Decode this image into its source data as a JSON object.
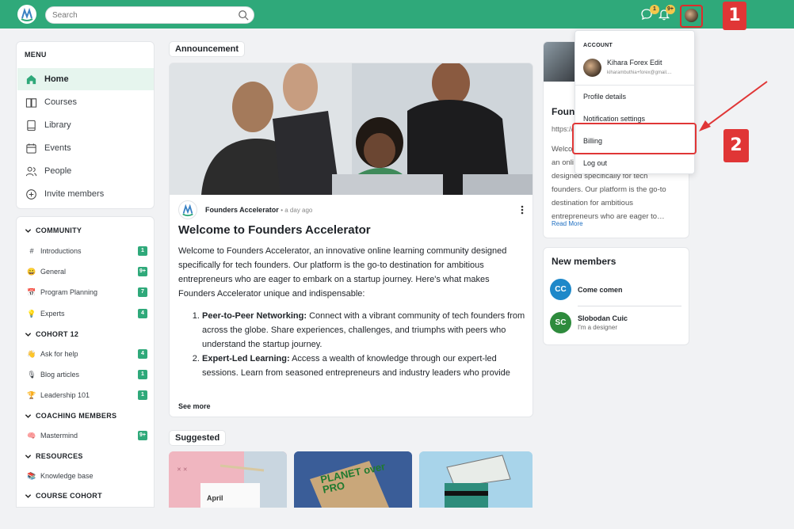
{
  "search": {
    "placeholder": "Search"
  },
  "header": {
    "chat_badge": "1",
    "notif_badge": "9+"
  },
  "steps": {
    "one": "1",
    "two": "2"
  },
  "menu": {
    "title": "MENU",
    "items": [
      {
        "label": "Home",
        "icon": "home-icon",
        "active": true
      },
      {
        "label": "Courses",
        "icon": "book-open-icon"
      },
      {
        "label": "Library",
        "icon": "library-icon"
      },
      {
        "label": "Events",
        "icon": "calendar-icon"
      },
      {
        "label": "People",
        "icon": "people-icon"
      },
      {
        "label": "Invite members",
        "icon": "plus-circle-icon"
      }
    ]
  },
  "community": {
    "sections": [
      {
        "title": "COMMUNITY",
        "channels": [
          {
            "emoji": "#",
            "label": "Introductions",
            "count": "1"
          },
          {
            "emoji": "😀",
            "label": "General",
            "count": "9+"
          },
          {
            "emoji": "📅",
            "label": "Program Planning",
            "count": "7"
          },
          {
            "emoji": "💡",
            "label": "Experts",
            "count": "4"
          }
        ]
      },
      {
        "title": "COHORT 12",
        "channels": [
          {
            "emoji": "👋",
            "label": "Ask for help",
            "count": "4"
          },
          {
            "emoji": "🎙",
            "label": "Blog articles",
            "count": "1"
          },
          {
            "emoji": "🏆",
            "label": "Leadership 101",
            "count": "1"
          }
        ]
      },
      {
        "title": "COACHING MEMBERS",
        "channels": [
          {
            "emoji": "🧠",
            "label": "Mastermind",
            "count": "9+"
          }
        ]
      },
      {
        "title": "RESOURCES",
        "channels": [
          {
            "emoji": "📚",
            "label": "Knowledge base",
            "count": ""
          }
        ]
      },
      {
        "title": "COURSE COHORT",
        "channels": []
      }
    ]
  },
  "announcement": {
    "tag": "Announcement",
    "author": "Founders Accelerator",
    "time": "• a day ago",
    "title": "Welcome to Founders Accelerator",
    "intro": "Welcome to Founders Accelerator, an innovative online learning community designed specifically for tech founders. Our platform is the go-to destination for ambitious entrepreneurs who are eager to embark on a startup journey. Here's what makes Founders Accelerator unique and indispensable:",
    "points": [
      {
        "head": "Peer-to-Peer Networking:",
        "text": " Connect with a vibrant community of tech founders from across the globe. Share experiences, challenges, and triumphs with peers who understand the startup journey."
      },
      {
        "head": "Expert-Led Learning:",
        "text": " Access a wealth of knowledge through our expert-led sessions. Learn from seasoned entrepreneurs and industry leaders who provide real-world insights and practical strategies tailored to the needs of tech startups."
      }
    ],
    "see_more": "See more"
  },
  "suggested": {
    "tag": "Suggested",
    "calendar_label": "April",
    "sign_text": "PLANET over PRO"
  },
  "side_card": {
    "title": "Foun",
    "url": "https://",
    "text_lines": [
      "Welco",
      "an onli",
      "designed specifically for tech",
      "founders. Our platform is the go-to",
      "destination for ambitious",
      "entrepreneurs who are eager to…"
    ],
    "read_more": "Read More"
  },
  "account_menu": {
    "heading": "ACCOUNT",
    "name": "Kihara Forex Edit",
    "email": "kiharambuthia+forex@gmail....",
    "items": [
      "Profile details",
      "Notification settings",
      "Billing",
      "Log out"
    ]
  },
  "new_members": {
    "title": "New members",
    "members": [
      {
        "initials": "CC",
        "name": "Come comen",
        "subtitle": "",
        "color": "#1e88c9"
      },
      {
        "initials": "SC",
        "name": "Slobodan Cuic",
        "subtitle": "I'm a designer",
        "color": "#2e8b3d"
      }
    ]
  },
  "colors": {
    "brand": "#2fa97a",
    "highlight": "#e03636",
    "badge": "#f5c84c"
  }
}
